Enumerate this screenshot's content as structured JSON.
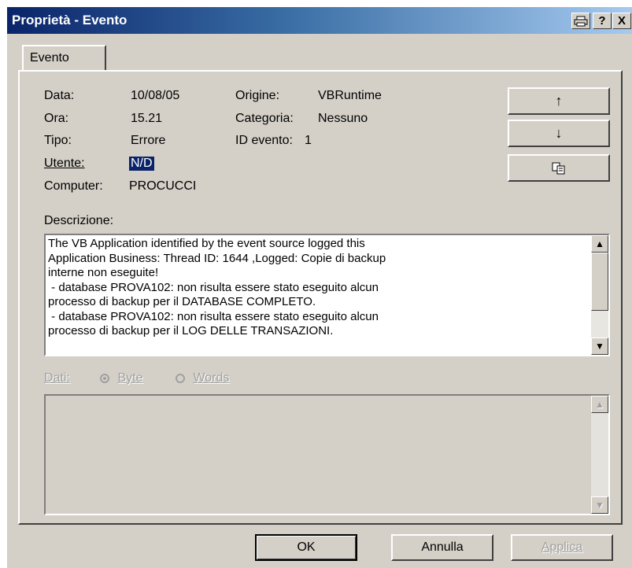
{
  "window": {
    "title": "Proprietà - Evento",
    "buttons": {
      "print_icon": "printer-icon",
      "help": "?",
      "close": "X"
    }
  },
  "tabs": [
    {
      "label": "Evento"
    }
  ],
  "fields": {
    "data_label": "Data:",
    "data_value": "10/08/05",
    "ora_label": "Ora:",
    "ora_value": "15.21",
    "tipo_label": "Tipo:",
    "tipo_value": "Errore",
    "utente_label": "Utente:",
    "utente_value": "N/D",
    "computer_label": "Computer:",
    "computer_value": "PROCUCCI",
    "origine_label": "Origine:",
    "origine_value": "VBRuntime",
    "categoria_label": "Categoria:",
    "categoria_value": "Nessuno",
    "idevento_label": "ID evento:",
    "idevento_value": "1"
  },
  "side_buttons": {
    "up": "↑",
    "down": "↓",
    "copy_icon": "copy-icon"
  },
  "description": {
    "label": "Descrizione:",
    "text": "The VB Application identified by the event source logged this\nApplication Business: Thread ID: 1644 ,Logged: Copie di backup\ninterne non eseguite!\n - database PROVA102: non risulta essere stato eseguito alcun\nprocesso di backup per il DATABASE COMPLETO.\n - database PROVA102: non risulta essere stato eseguito alcun\nprocesso di backup per il LOG DELLE TRANSAZIONI."
  },
  "dati": {
    "label": "Dati:",
    "byte": "Byte",
    "words": "Words",
    "selected": "Byte"
  },
  "footer": {
    "ok": "OK",
    "cancel": "Annulla",
    "apply": "Applica"
  }
}
